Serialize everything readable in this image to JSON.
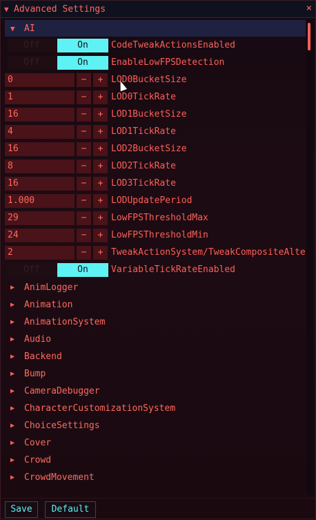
{
  "window": {
    "title": "Advanced Settings",
    "close_glyph": "×"
  },
  "ai_section": {
    "label": "AI",
    "expanded": true
  },
  "ai_rows": [
    {
      "type": "toggle",
      "off_label": "Off",
      "on_label": "On",
      "label": "CodeTweakActionsEnabled"
    },
    {
      "type": "toggle",
      "off_label": "Off",
      "on_label": "On",
      "label": "EnableLowFPSDetection"
    },
    {
      "type": "number",
      "value": "0",
      "label": "LOD0BucketSize"
    },
    {
      "type": "number",
      "value": "1",
      "label": "LOD0TickRate"
    },
    {
      "type": "number",
      "value": "16",
      "label": "LOD1BucketSize"
    },
    {
      "type": "number",
      "value": "4",
      "label": "LOD1TickRate"
    },
    {
      "type": "number",
      "value": "16",
      "label": "LOD2BucketSize"
    },
    {
      "type": "number",
      "value": "8",
      "label": "LOD2TickRate"
    },
    {
      "type": "number",
      "value": "16",
      "label": "LOD3TickRate"
    },
    {
      "type": "number",
      "value": "1.000",
      "label": "LODUpdatePeriod"
    },
    {
      "type": "number",
      "value": "29",
      "label": "LowFPSThresholdMax"
    },
    {
      "type": "number",
      "value": "24",
      "label": "LowFPSThresholdMin"
    },
    {
      "type": "number",
      "value": "2",
      "label": "TweakActionSystem/TweakCompositeAltern"
    },
    {
      "type": "toggle",
      "off_label": "Off",
      "on_label": "On",
      "label": "VariableTickRateEnabled"
    }
  ],
  "stepper": {
    "minus": "−",
    "plus": "+"
  },
  "collapsed_sections": [
    "AnimLogger",
    "Animation",
    "AnimationSystem",
    "Audio",
    "Backend",
    "Bump",
    "CameraDebugger",
    "CharacterCustomizationSystem",
    "ChoiceSettings",
    "Cover",
    "Crowd",
    "CrowdMovement"
  ],
  "footer": {
    "save_label": "Save",
    "default_label": "Default"
  },
  "colors": {
    "accent": "#ff5f57",
    "on_button": "#5ef2f4",
    "field_bg": "#4a1219",
    "header_bg": "#1f2140"
  },
  "icons": {
    "expanded": "triangle-down-icon",
    "collapsed": "triangle-right-icon",
    "close": "close-icon",
    "cursor": "mouse-cursor"
  }
}
